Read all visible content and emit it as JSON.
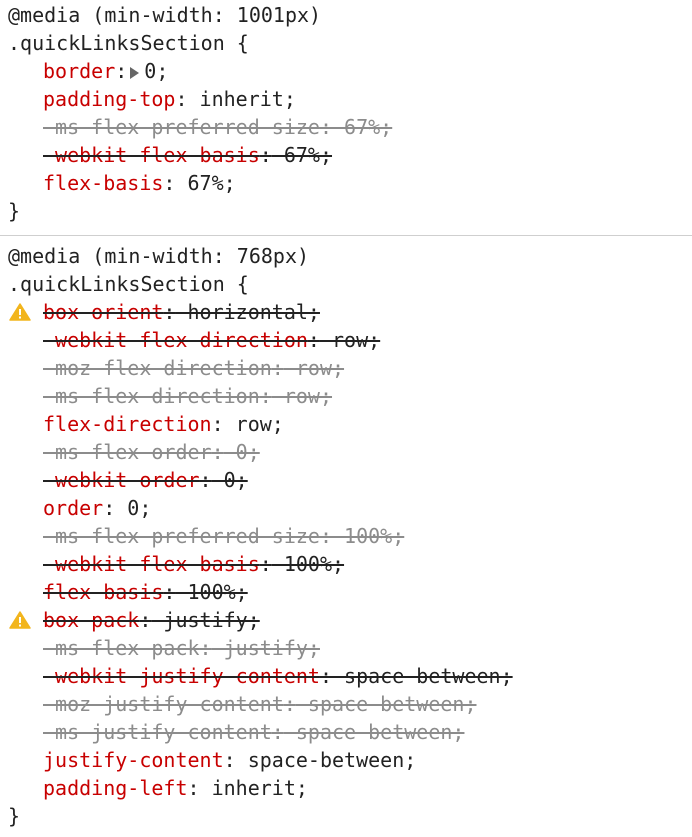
{
  "rules": [
    {
      "media": "@media (min-width: 1001px)",
      "selector": ".quickLinksSection {",
      "close": "}",
      "declarations": [
        {
          "prop": "border",
          "sep": ":",
          "value": "0;",
          "state": "active",
          "expandable": true
        },
        {
          "prop": "padding-top",
          "sep": ":",
          "value": " inherit;",
          "state": "active"
        },
        {
          "prop": "-ms-flex-preferred-size",
          "sep": ":",
          "value": " 67%;",
          "state": "inactive"
        },
        {
          "prop": "-webkit-flex-basis",
          "sep": ":",
          "value": " 67%;",
          "state": "overridden"
        },
        {
          "prop": "flex-basis",
          "sep": ":",
          "value": " 67%;",
          "state": "active"
        }
      ]
    },
    {
      "media": "@media (min-width: 768px)",
      "selector": ".quickLinksSection {",
      "close": "}",
      "declarations": [
        {
          "prop": "box-orient",
          "sep": ":",
          "value": " horizontal;",
          "state": "overridden",
          "warning": true
        },
        {
          "prop": "-webkit-flex-direction",
          "sep": ":",
          "value": " row;",
          "state": "overridden"
        },
        {
          "prop": "-moz-flex-direction",
          "sep": ":",
          "value": " row;",
          "state": "inactive"
        },
        {
          "prop": "-ms-flex-direction",
          "sep": ":",
          "value": " row;",
          "state": "inactive"
        },
        {
          "prop": "flex-direction",
          "sep": ":",
          "value": " row;",
          "state": "active"
        },
        {
          "prop": "-ms-flex-order",
          "sep": ":",
          "value": " 0;",
          "state": "inactive"
        },
        {
          "prop": "-webkit-order",
          "sep": ":",
          "value": " 0;",
          "state": "overridden"
        },
        {
          "prop": "order",
          "sep": ":",
          "value": " 0;",
          "state": "active"
        },
        {
          "prop": "-ms-flex-preferred-size",
          "sep": ":",
          "value": " 100%;",
          "state": "inactive"
        },
        {
          "prop": "-webkit-flex-basis",
          "sep": ":",
          "value": " 100%;",
          "state": "overridden"
        },
        {
          "prop": "flex-basis",
          "sep": ":",
          "value": " 100%;",
          "state": "overridden"
        },
        {
          "prop": "box-pack",
          "sep": ":",
          "value": " justify;",
          "state": "overridden",
          "warning": true
        },
        {
          "prop": "-ms-flex-pack",
          "sep": ":",
          "value": " justify;",
          "state": "inactive"
        },
        {
          "prop": "-webkit-justify-content",
          "sep": ":",
          "value": " space-between;",
          "state": "overridden"
        },
        {
          "prop": "-moz-justify-content",
          "sep": ":",
          "value": " space-between;",
          "state": "inactive"
        },
        {
          "prop": "-ms-justify-content",
          "sep": ":",
          "value": " space-between;",
          "state": "inactive"
        },
        {
          "prop": "justify-content",
          "sep": ":",
          "value": " space-between;",
          "state": "active"
        },
        {
          "prop": "padding-left",
          "sep": ":",
          "value": " inherit;",
          "state": "active"
        }
      ]
    }
  ],
  "icons": {
    "warning": "warning-icon",
    "expand": "expand-triangle-icon"
  },
  "colors": {
    "property": "#c80000",
    "value": "#222222",
    "inactive": "#8c8c8c",
    "warning": "#f2b51d"
  }
}
